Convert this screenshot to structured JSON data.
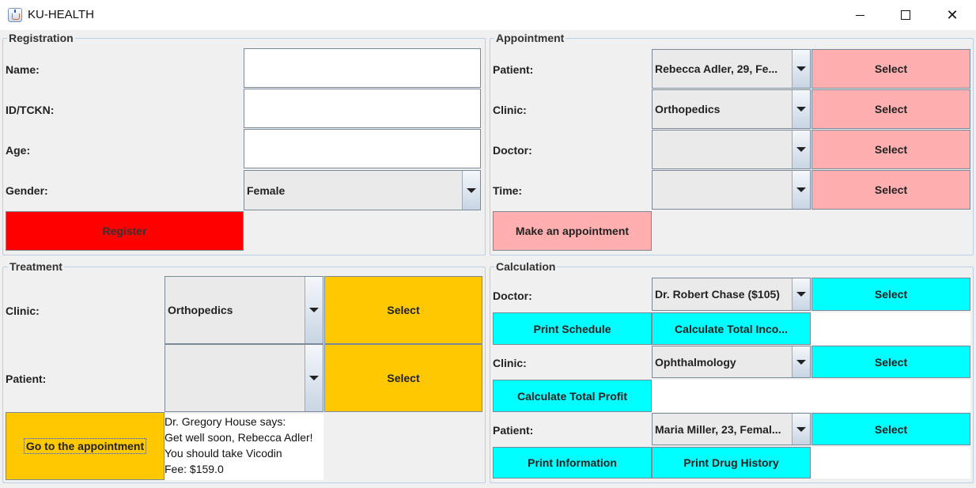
{
  "window": {
    "title": "KU-HEALTH"
  },
  "registration": {
    "title": "Registration",
    "name_label": "Name:",
    "name_value": "",
    "id_label": "ID/TCKN:",
    "id_value": "",
    "age_label": "Age:",
    "age_value": "",
    "gender_label": "Gender:",
    "gender_selected": "Female",
    "register_button": "Register"
  },
  "appointment": {
    "title": "Appointment",
    "patient_label": "Patient:",
    "patient_selected": "Rebecca Adler, 29, Fe...",
    "clinic_label": "Clinic:",
    "clinic_selected": "Orthopedics",
    "doctor_label": "Doctor:",
    "doctor_selected": "",
    "time_label": "Time:",
    "time_selected": "",
    "select_button": "Select",
    "make_button": "Make an appointment"
  },
  "treatment": {
    "title": "Treatment",
    "clinic_label": "Clinic:",
    "clinic_selected": "Orthopedics",
    "patient_label": "Patient:",
    "patient_selected": "",
    "select_button": "Select",
    "goto_button": "Go to the appointment",
    "message_lines": [
      "Dr. Gregory House says:",
      "Get well soon, Rebecca Adler!",
      "You should take Vicodin",
      "Fee: $159.0"
    ]
  },
  "calculation": {
    "title": "Calculation",
    "doctor_label": "Doctor:",
    "doctor_selected": "Dr. Robert Chase ($105)",
    "select_button": "Select",
    "print_schedule_button": "Print Schedule",
    "total_income_button": "Calculate Total Inco...",
    "clinic_label": "Clinic:",
    "clinic_selected": "Ophthalmology",
    "total_profit_button": "Calculate Total Profit",
    "patient_label": "Patient:",
    "patient_selected": "Maria Miller, 23, Femal...",
    "print_info_button": "Print Information",
    "print_drug_button": "Print Drug History"
  },
  "colors": {
    "register": "#ff0000",
    "appointment_buttons": "#ffafaf",
    "treatment_buttons": "#ffc800",
    "calculation_buttons": "#00ffff"
  }
}
